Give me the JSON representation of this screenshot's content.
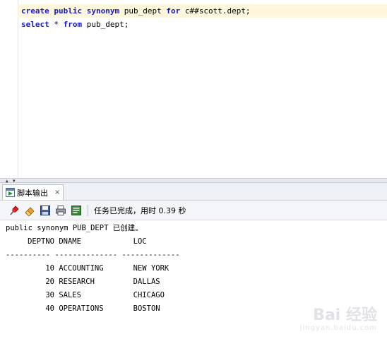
{
  "editor": {
    "line1": {
      "kw_create": "create",
      "kw_public": "public",
      "kw_synonym": "synonym",
      "name": "pub_dept",
      "kw_for": "for",
      "target": "c##scott.dept;"
    },
    "line2": {
      "kw_select": "select",
      "star": "*",
      "kw_from": "from",
      "table": "pub_dept;"
    }
  },
  "output_panel": {
    "tab_label": "脚本输出",
    "tab_close": "×",
    "status": "任务已完成，用时 0.39 秒",
    "toolbar_icons": [
      "pin-icon",
      "eraser-icon",
      "save-icon",
      "print-icon",
      "open-log-icon"
    ]
  },
  "results": {
    "message": "public synonym PUB_DEPT 已创建。",
    "columns": [
      "DEPTNO",
      "DNAME",
      "LOC"
    ],
    "separator": "---------- -------------- -------------",
    "rows": [
      {
        "deptno": "10",
        "dname": "ACCOUNTING",
        "loc": "NEW YORK"
      },
      {
        "deptno": "20",
        "dname": "RESEARCH",
        "loc": "DALLAS"
      },
      {
        "deptno": "30",
        "dname": "SALES",
        "loc": "CHICAGO"
      },
      {
        "deptno": "40",
        "dname": "OPERATIONS",
        "loc": "BOSTON"
      }
    ]
  },
  "watermark": {
    "main": "Bai 经验",
    "sub": "jingyan.baidu.com"
  },
  "colors": {
    "keyword": "#1a1ac8",
    "current_line": "#fbf6dc"
  }
}
